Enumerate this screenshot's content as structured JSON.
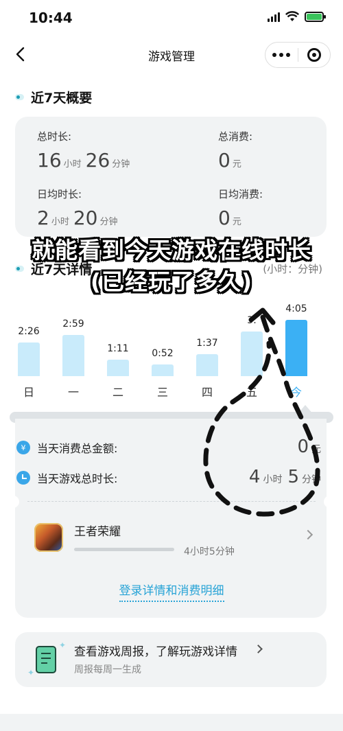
{
  "status_bar": {
    "time": "10:44"
  },
  "nav": {
    "title": "游戏管理"
  },
  "overview": {
    "section_title": "近7天概要",
    "total_duration": {
      "label": "总时长:",
      "hours": "16",
      "hours_unit": "小时",
      "minutes": "26",
      "minutes_unit": "分钟"
    },
    "total_spend": {
      "label": "总消费:",
      "value": "0",
      "unit": "元"
    },
    "daily_duration": {
      "label": "日均时长:",
      "hours": "2",
      "hours_unit": "小时",
      "minutes": "20",
      "minutes_unit": "分钟"
    },
    "daily_spend": {
      "label": "日均消费:",
      "value": "0",
      "unit": "元"
    }
  },
  "caption": {
    "line1": "就能看到今天游戏在线时长",
    "line2": "(已经玩了多久)"
  },
  "details": {
    "section_title": "近7天详情",
    "units_note": "(小时：分钟)"
  },
  "chart_data": {
    "type": "bar",
    "categories": [
      "日",
      "一",
      "二",
      "三",
      "四",
      "五",
      "今"
    ],
    "labels": [
      "2:26",
      "2:59",
      "1:11",
      "0:52",
      "1:37",
      "3:",
      "4:05"
    ],
    "values": [
      146,
      179,
      71,
      52,
      97,
      195,
      245
    ],
    "value_unit": "minutes",
    "highlight_index": 6,
    "colors": {
      "bar": "#c9ebfb",
      "today": "#3bb0f4"
    }
  },
  "today": {
    "spend_label": "当天消费总金额:",
    "spend_value": "0",
    "spend_unit": "元",
    "duration_label": "当天游戏总时长:",
    "hours": "4",
    "hours_unit": "小时",
    "minutes": "5",
    "minutes_unit": "分钟",
    "coin_symbol": "¥"
  },
  "game": {
    "name": "王者荣耀",
    "duration": "4小时5分钟",
    "icon": "honor-of-kings-icon"
  },
  "detail_link": "登录详情和消费明细",
  "report": {
    "title": "查看游戏周报，了解玩游戏详情",
    "subtitle": "周报每周一生成"
  },
  "colors": {
    "accent": "#3bb0f4",
    "link": "#27a3d6",
    "card": "#f1f3f4"
  }
}
